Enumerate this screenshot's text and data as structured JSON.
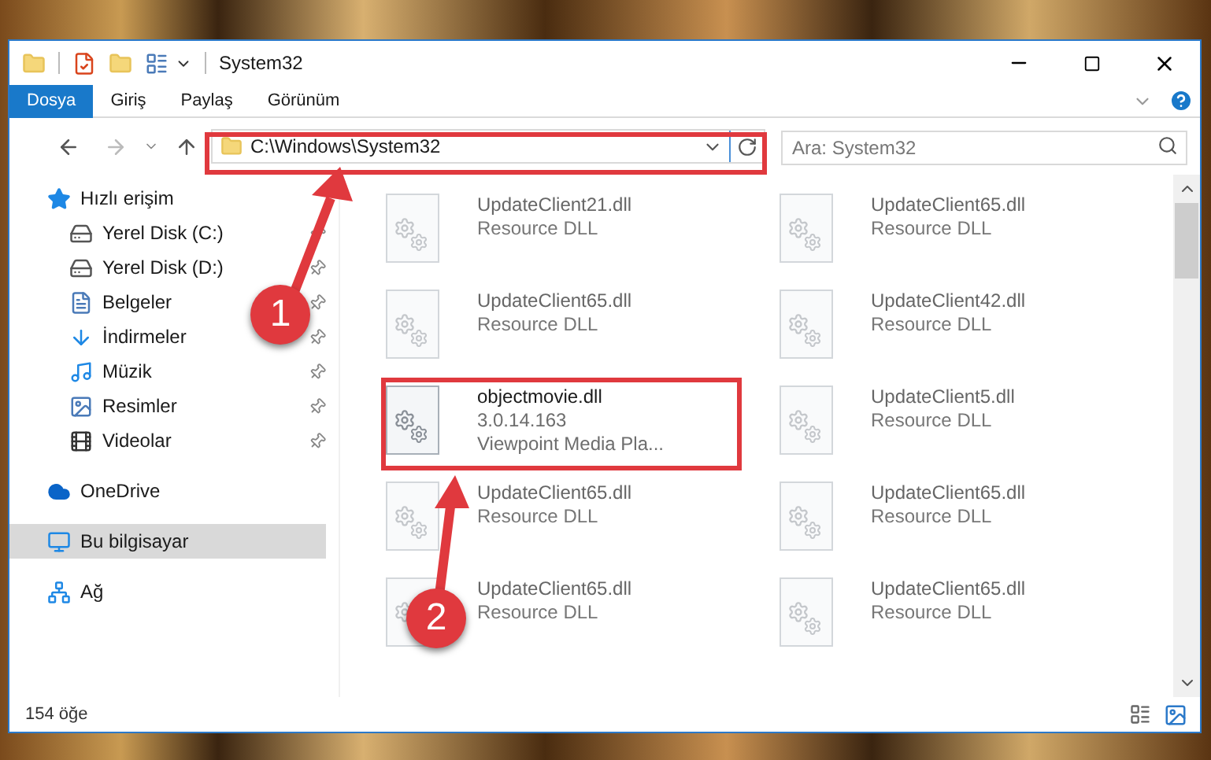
{
  "window": {
    "title": "System32"
  },
  "ribbon_tabs": [
    {
      "label": "Dosya",
      "selected": true
    },
    {
      "label": "Giriş",
      "selected": false
    },
    {
      "label": "Paylaş",
      "selected": false
    },
    {
      "label": "Görünüm",
      "selected": false
    }
  ],
  "address": {
    "path": "C:\\Windows\\System32"
  },
  "search": {
    "placeholder": "Ara: System32"
  },
  "sidebar": {
    "items": [
      {
        "label": "Hızlı erişim",
        "kind": "star",
        "selected": false,
        "children": [
          {
            "label": "Yerel Disk (C:)",
            "kind": "drive-win",
            "pinned": true,
            "selected": false
          },
          {
            "label": "Yerel Disk (D:)",
            "kind": "drive",
            "pinned": true,
            "selected": false
          },
          {
            "label": "Belgeler",
            "kind": "docs",
            "pinned": true,
            "selected": false
          },
          {
            "label": "İndirmeler",
            "kind": "download",
            "pinned": true,
            "selected": false
          },
          {
            "label": "Müzik",
            "kind": "music",
            "pinned": true,
            "selected": false
          },
          {
            "label": "Resimler",
            "kind": "pictures",
            "pinned": true,
            "selected": false
          },
          {
            "label": "Videolar",
            "kind": "videos",
            "pinned": true,
            "selected": false
          }
        ]
      },
      {
        "label": "OneDrive",
        "kind": "cloud",
        "selected": false
      },
      {
        "label": "Bu bilgisayar",
        "kind": "pc",
        "selected": true
      },
      {
        "label": "Ağ",
        "kind": "network",
        "selected": false
      }
    ]
  },
  "files": [
    {
      "name": "UpdateClient21.dll",
      "lines": [
        "Resource DLL"
      ],
      "blurred": true
    },
    {
      "name": "UpdateClient65.dll",
      "lines": [
        "Resource DLL"
      ],
      "blurred": true
    },
    {
      "name": "UpdateClient65.dll",
      "lines": [
        "Resource DLL"
      ],
      "blurred": true
    },
    {
      "name": "UpdateClient42.dll",
      "lines": [
        "Resource DLL"
      ],
      "blurred": true
    },
    {
      "name": "objectmovie.dll",
      "lines": [
        "3.0.14.163",
        "Viewpoint Media Pla..."
      ],
      "blurred": false
    },
    {
      "name": "UpdateClient5.dll",
      "lines": [
        "Resource DLL"
      ],
      "blurred": true
    },
    {
      "name": "UpdateClient65.dll",
      "lines": [
        "Resource DLL"
      ],
      "blurred": true
    },
    {
      "name": "UpdateClient65.dll",
      "lines": [
        "Resource DLL"
      ],
      "blurred": true
    },
    {
      "name": "UpdateClient65.dll",
      "lines": [
        "Resource DLL"
      ],
      "blurred": true
    },
    {
      "name": "UpdateClient65.dll",
      "lines": [
        "Resource DLL"
      ],
      "blurred": true
    }
  ],
  "status_bar": {
    "count": "154 öğe"
  },
  "annotations": [
    {
      "number": "1"
    },
    {
      "number": "2"
    }
  ]
}
